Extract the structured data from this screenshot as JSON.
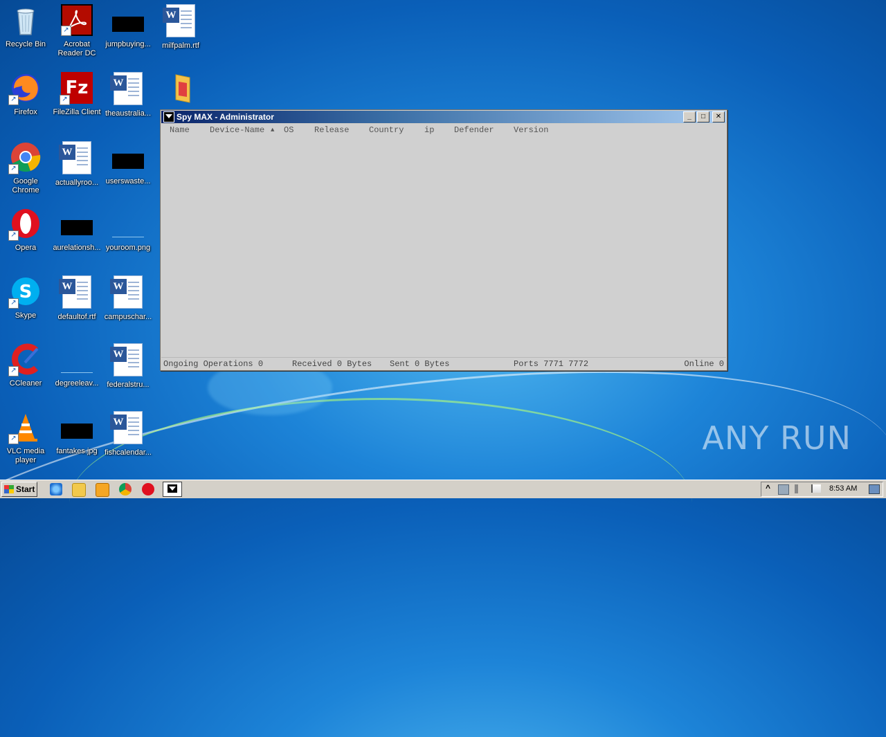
{
  "desktop": {
    "icons": [
      {
        "label": "Recycle Bin"
      },
      {
        "label": "Acrobat Reader DC"
      },
      {
        "label": "jumpbuying..."
      },
      {
        "label": "milfpalm.rtf"
      },
      {
        "label": "Firefox"
      },
      {
        "label": "FileZilla Client"
      },
      {
        "label": "theaustralia..."
      },
      {
        "label": "Google Chrome"
      },
      {
        "label": "actuallyroo..."
      },
      {
        "label": "userswaste..."
      },
      {
        "label": "Opera"
      },
      {
        "label": "aurelationsh..."
      },
      {
        "label": "youroom.png"
      },
      {
        "label": "Skype"
      },
      {
        "label": "defaultof.rtf"
      },
      {
        "label": "campuschar..."
      },
      {
        "label": "CCleaner"
      },
      {
        "label": "degreeleav..."
      },
      {
        "label": "federalstru..."
      },
      {
        "label": "VLC media player"
      },
      {
        "label": "fantakes.jpg"
      },
      {
        "label": "fishcalendar..."
      }
    ]
  },
  "window": {
    "title": "Spy MAX - Administrator",
    "controls": {
      "minimize": "_",
      "maximize": "□",
      "close": "✕"
    },
    "columns": [
      "Name",
      "Device-Name",
      "OS",
      "Release",
      "Country",
      "ip",
      "Defender",
      "Version"
    ],
    "sort_indicator": "▲",
    "status": {
      "ongoing": "Ongoing Operations 0",
      "received": "Received 0 Bytes",
      "sent": "Sent 0 Bytes",
      "ports": "Ports 7771 7772",
      "online": "Online 0"
    }
  },
  "taskbar": {
    "start_label": "Start",
    "clock": "8:53 AM",
    "tray_arrow": "^"
  },
  "watermark": "ANY RUN",
  "colors": {
    "title_start": "#0a246a",
    "title_end": "#a6caf0",
    "window_bg": "#d4d0c8"
  }
}
